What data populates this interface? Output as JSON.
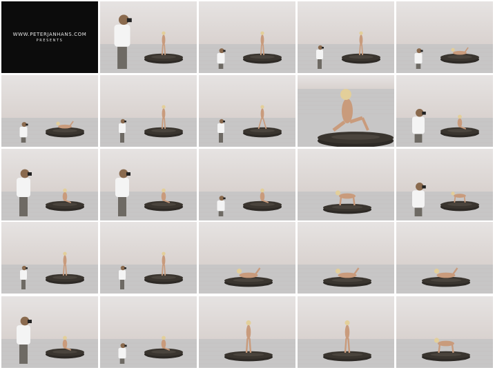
{
  "title_card": {
    "line1": "WWW.PETERJANHANS.COM",
    "line2": "PRESENTS"
  },
  "thumbnails": [
    {
      "kind": "title"
    },
    {
      "kind": "both",
      "photographer": "big-left",
      "model": "standing"
    },
    {
      "kind": "both",
      "photographer": "crouch",
      "model": "standing"
    },
    {
      "kind": "both",
      "photographer": "stand",
      "model": "standing"
    },
    {
      "kind": "both",
      "photographer": "crouch",
      "model": "lying"
    },
    {
      "kind": "both",
      "photographer": "crouch",
      "model": "lying"
    },
    {
      "kind": "both",
      "photographer": "stand",
      "model": "standing"
    },
    {
      "kind": "both",
      "photographer": "stand",
      "model": "standing-wide"
    },
    {
      "kind": "model-close",
      "model": "kneel-big"
    },
    {
      "kind": "both",
      "photographer": "big-crouch",
      "model": "sit"
    },
    {
      "kind": "both",
      "photographer": "big-stand",
      "model": "sit"
    },
    {
      "kind": "both",
      "photographer": "big-stand",
      "model": "sit"
    },
    {
      "kind": "both",
      "photographer": "crouch",
      "model": "sit"
    },
    {
      "kind": "model-only",
      "model": "crawl"
    },
    {
      "kind": "both",
      "photographer": "big-crouch",
      "model": "crawl"
    },
    {
      "kind": "both",
      "photographer": "stand",
      "model": "standing"
    },
    {
      "kind": "both",
      "photographer": "stand",
      "model": "standing"
    },
    {
      "kind": "model-only",
      "model": "recline"
    },
    {
      "kind": "model-only",
      "model": "recline"
    },
    {
      "kind": "model-only",
      "model": "recline"
    },
    {
      "kind": "both",
      "photographer": "big-stand",
      "model": "sit"
    },
    {
      "kind": "both",
      "photographer": "crouch",
      "model": "sit"
    },
    {
      "kind": "model-only",
      "model": "standing"
    },
    {
      "kind": "model-only",
      "model": "standing"
    },
    {
      "kind": "model-only",
      "model": "crawl"
    }
  ],
  "colors": {
    "sky_top": "#e6e3e2",
    "sky_bottom": "#d9d2cf",
    "water": "#c7c6c6",
    "tire": "#2e2a26",
    "skin": "#c99b7c",
    "hair": "#e3cf9a",
    "shirt": "#f4f4f4",
    "pants": "#6e6a64",
    "title_bg": "#0c0c0c",
    "title_text": "#e8e8e8"
  }
}
